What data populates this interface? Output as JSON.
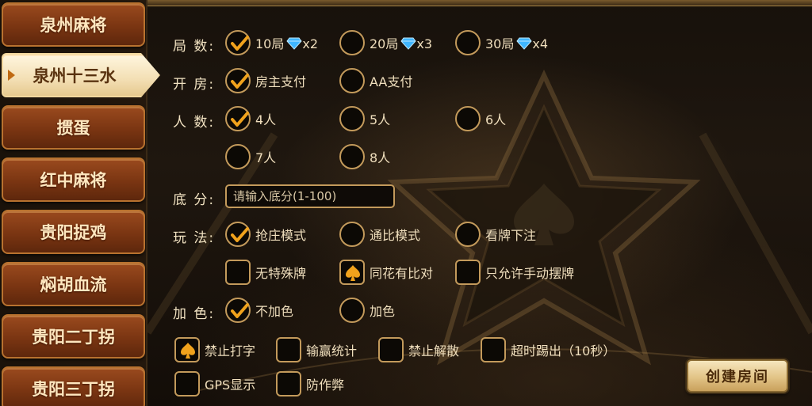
{
  "sidebar": {
    "items": [
      {
        "label": "泉州麻将",
        "active": false
      },
      {
        "label": "泉州十三水",
        "active": true
      },
      {
        "label": "掼蛋",
        "active": false
      },
      {
        "label": "红中麻将",
        "active": false
      },
      {
        "label": "贵阳捉鸡",
        "active": false
      },
      {
        "label": "焖胡血流",
        "active": false
      },
      {
        "label": "贵阳二丁拐",
        "active": false
      },
      {
        "label": "贵阳三丁拐",
        "active": false
      }
    ]
  },
  "form": {
    "rounds": {
      "label": "局  数:",
      "options": [
        {
          "text": "10局",
          "cost": "x2",
          "selected": true
        },
        {
          "text": "20局",
          "cost": "x3",
          "selected": false
        },
        {
          "text": "30局",
          "cost": "x4",
          "selected": false
        }
      ]
    },
    "room": {
      "label": "开  房:",
      "options": [
        {
          "text": "房主支付",
          "selected": true
        },
        {
          "text": "AA支付",
          "selected": false
        }
      ]
    },
    "players": {
      "label": "人  数:",
      "options": [
        {
          "text": "4人",
          "selected": true
        },
        {
          "text": "5人",
          "selected": false
        },
        {
          "text": "6人",
          "selected": false
        },
        {
          "text": "7人",
          "selected": false
        },
        {
          "text": "8人",
          "selected": false
        }
      ]
    },
    "base_score": {
      "label": "底  分:",
      "placeholder": "请输入底分(1-100)"
    },
    "play_mode": {
      "label": "玩  法:",
      "options": [
        {
          "text": "抢庄模式",
          "selected": true
        },
        {
          "text": "通比模式",
          "selected": false
        },
        {
          "text": "看牌下注",
          "selected": false
        }
      ],
      "extras": [
        {
          "text": "无特殊牌",
          "checked": false
        },
        {
          "text": "同花有比对",
          "checked": true
        },
        {
          "text": "只允许手动摆牌",
          "checked": false
        }
      ]
    },
    "color": {
      "label": "加  色:",
      "options": [
        {
          "text": "不加色",
          "selected": true
        },
        {
          "text": "加色",
          "selected": false
        }
      ]
    },
    "toggles": [
      {
        "text": "禁止打字",
        "checked": true
      },
      {
        "text": "输赢统计",
        "checked": false
      },
      {
        "text": "禁止解散",
        "checked": false
      },
      {
        "text": "超时踢出（10秒）",
        "checked": false
      },
      {
        "text": "GPS显示",
        "checked": false
      },
      {
        "text": "防作弊",
        "checked": false
      }
    ]
  },
  "create_button": {
    "label": "创建房间"
  },
  "colors": {
    "accent_gold": "#f0a21c",
    "border_gold": "#c39a5b",
    "sidebar_brown": "#7a3512",
    "gem_blue": "#3fb6ff"
  },
  "icons": {
    "check": "check-icon",
    "spade": "spade-icon",
    "gem": "diamond-gem-icon"
  }
}
